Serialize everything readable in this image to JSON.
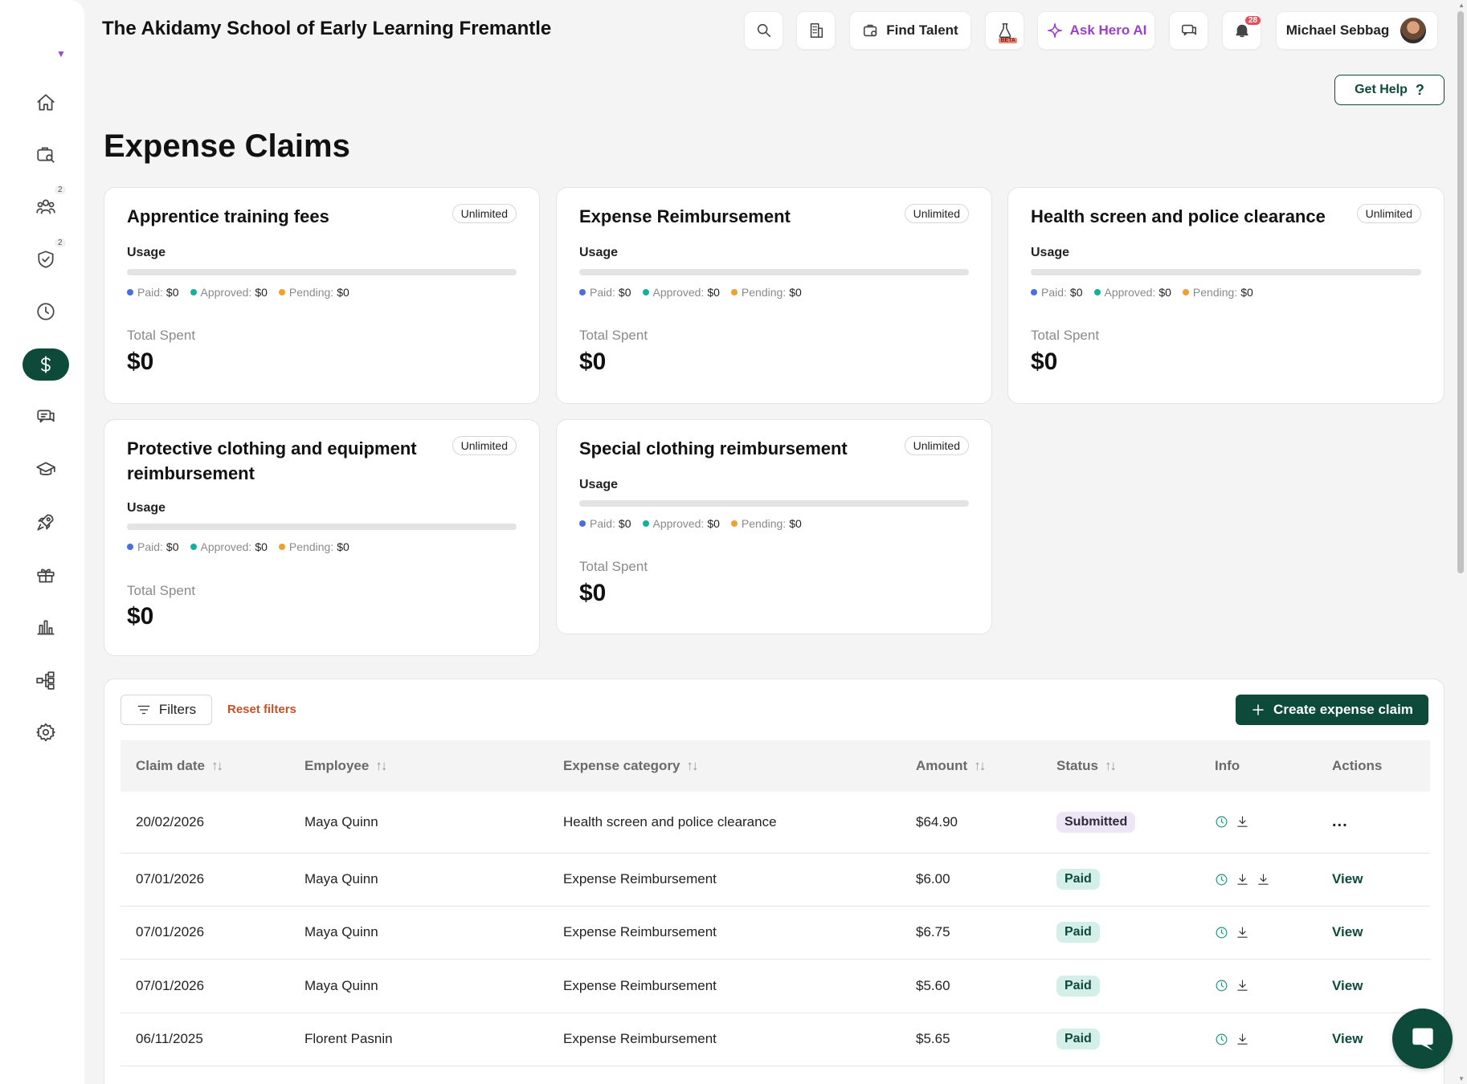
{
  "app": {
    "title": "The Akidamy School of Early Learning Fremantle"
  },
  "header": {
    "find_talent": "Find Talent",
    "ask_ai": "Ask Hero AI",
    "beta": "BETA",
    "notifications_count": "28",
    "user_name": "Michael Sebbag"
  },
  "sidebar": {
    "items": [
      {
        "icon": "home-icon"
      },
      {
        "icon": "briefcase-search-icon"
      },
      {
        "icon": "people-icon",
        "badge": "2"
      },
      {
        "icon": "shield-check-icon",
        "badge": "2"
      },
      {
        "icon": "clock-icon"
      },
      {
        "icon": "dollar-icon",
        "active": true
      },
      {
        "icon": "chat-icon"
      },
      {
        "icon": "graduation-cap-icon"
      },
      {
        "icon": "rocket-icon"
      },
      {
        "icon": "gift-icon"
      },
      {
        "icon": "bar-chart-icon"
      },
      {
        "icon": "org-chart-icon"
      },
      {
        "icon": "settings-icon"
      }
    ]
  },
  "get_help": "Get Help",
  "get_help_icon": "?",
  "page_title": "Expense Claims",
  "legend_labels": {
    "paid": "Paid:",
    "approved": "Approved:",
    "pending": "Pending:"
  },
  "colors": {
    "paid": "#4a6ee0",
    "approved": "#14b09a",
    "pending": "#f0a030",
    "accent": "#0d4a3a"
  },
  "cards": [
    {
      "title": "Apprentice training fees",
      "badge": "Unlimited",
      "usage_label": "Usage",
      "paid": "$0",
      "approved": "$0",
      "pending": "$0",
      "total_label": "Total Spent",
      "total": "$0"
    },
    {
      "title": "Expense Reimbursement",
      "badge": "Unlimited",
      "usage_label": "Usage",
      "paid": "$0",
      "approved": "$0",
      "pending": "$0",
      "total_label": "Total Spent",
      "total": "$0"
    },
    {
      "title": "Health screen and police clearance",
      "badge": "Unlimited",
      "usage_label": "Usage",
      "paid": "$0",
      "approved": "$0",
      "pending": "$0",
      "total_label": "Total Spent",
      "total": "$0"
    },
    {
      "title": "Protective clothing and equipment reimbursement",
      "badge": "Unlimited",
      "usage_label": "Usage",
      "paid": "$0",
      "approved": "$0",
      "pending": "$0",
      "total_label": "Total Spent",
      "total": "$0"
    },
    {
      "title": "Special clothing reimbursement",
      "badge": "Unlimited",
      "usage_label": "Usage",
      "paid": "$0",
      "approved": "$0",
      "pending": "$0",
      "total_label": "Total Spent",
      "total": "$0"
    }
  ],
  "table": {
    "filters_label": "Filters",
    "reset_filters": "Reset filters",
    "create_label": "Create expense claim",
    "columns": [
      "Claim date",
      "Employee",
      "Expense category",
      "Amount",
      "Status",
      "Info",
      "Actions"
    ],
    "rows": [
      {
        "date": "20/02/2026",
        "employee": "Maya Quinn",
        "category": "Health screen and police clearance",
        "amount": "$64.90",
        "status": "Submitted",
        "downloads": 1,
        "action": "..."
      },
      {
        "date": "07/01/2026",
        "employee": "Maya Quinn",
        "category": "Expense Reimbursement",
        "amount": "$6.00",
        "status": "Paid",
        "downloads": 2,
        "action": "View"
      },
      {
        "date": "07/01/2026",
        "employee": "Maya Quinn",
        "category": "Expense Reimbursement",
        "amount": "$6.75",
        "status": "Paid",
        "downloads": 1,
        "action": "View"
      },
      {
        "date": "07/01/2026",
        "employee": "Maya Quinn",
        "category": "Expense Reimbursement",
        "amount": "$5.60",
        "status": "Paid",
        "downloads": 1,
        "action": "View"
      },
      {
        "date": "06/11/2025",
        "employee": "Florent Pasnin",
        "category": "Expense Reimbursement",
        "amount": "$5.65",
        "status": "Paid",
        "downloads": 1,
        "action": "View"
      }
    ]
  }
}
